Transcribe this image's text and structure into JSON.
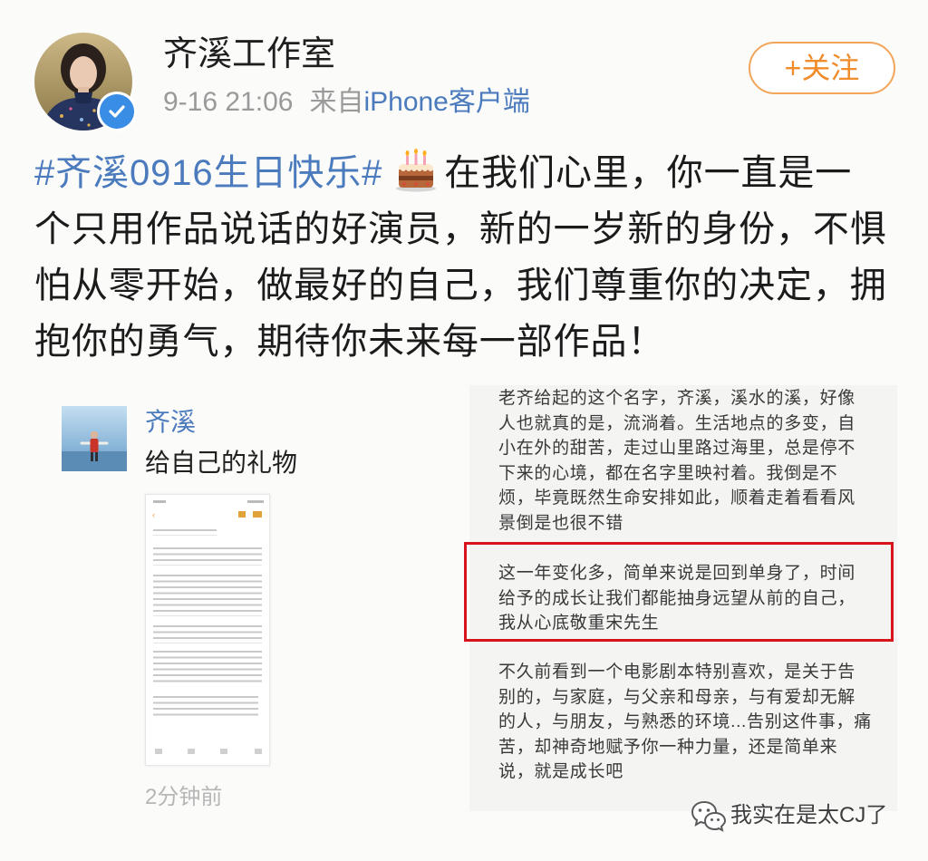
{
  "post": {
    "author": {
      "name": "齐溪工作室",
      "verified": true
    },
    "meta": {
      "time": "9-16 21:06",
      "source_prefix": "来自",
      "source": "iPhone客户端"
    },
    "follow_label": "+关注",
    "hashtag": "#齐溪0916生日快乐#",
    "emoji_icon": "birthday-cake-icon",
    "text_lines": [
      "在我们心里，你一直是一",
      "个只用作品说话的好演员，新的一岁新的身份，不惧",
      "怕从零开始，做最好的自己，我们尊重你的决定，拥",
      "抱你的勇气，期待你未来每一部作品！"
    ]
  },
  "shared_card": {
    "author": "齐溪",
    "title": "给自己的礼物",
    "time": "2分钟前",
    "thumbnail": "notes-screenshot-thumbnail"
  },
  "screenshot_text": {
    "top_lines": [
      "老齐给起的这个名字，齐溪，溪水的溪，好像",
      "人也就真的是，流淌着。生活地点的多变，自",
      "小在外的甜苦，走过山里路过海里，总是停不",
      "下来的心境，都在名字里映衬着。我倒是不",
      "烦，毕竟既然生命安排如此，顺着走着看看风",
      "景倒是也很不错"
    ],
    "highlighted_lines": [
      "这一年变化多，简单来说是回到单身了，时间",
      "给予的成长让我们都能抽身远望从前的自己，",
      "我从心底敬重宋先生"
    ],
    "bottom_lines": [
      "不久前看到一个电影剧本特别喜欢，是关于告",
      "别的，与家庭，与父亲和母亲，与有爱却无解",
      "的人，与朋友，与熟悉的环境...告别这件事，痛",
      "苦，却神奇地赋予你一种力量，还是简单来",
      "说，就是成长吧"
    ]
  },
  "watermark": {
    "icon": "wechat-icon",
    "text": "我实在是太CJ了"
  },
  "colors": {
    "link": "#4b7bbd",
    "accent": "#f08c2a",
    "highlight": "#d7131b",
    "verified_badge": "#3a8de4"
  }
}
